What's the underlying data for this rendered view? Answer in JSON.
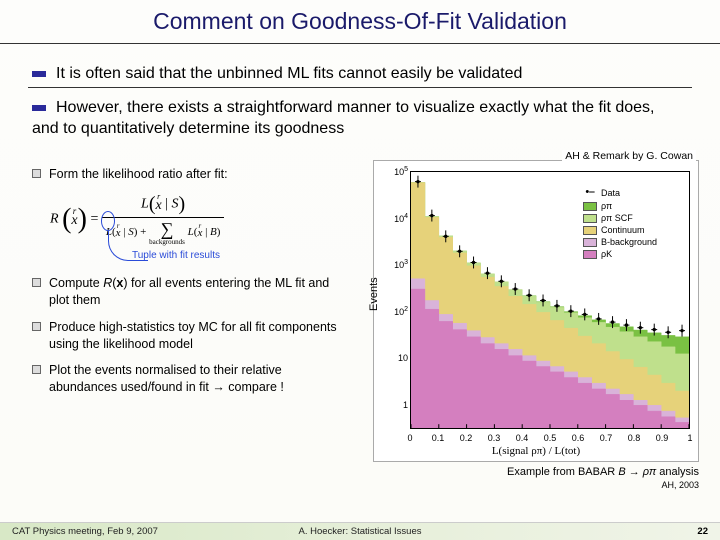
{
  "title": "Comment on Goodness-Of-Fit Validation",
  "bullets": {
    "b1": "It is often said that the unbinned ML fits cannot easily be validated",
    "b2": "However, there exists a straightforward manner to visualize exactly what the fit does, and to quantitatively determine its goodness"
  },
  "subs": {
    "s1": "Form the likelihood ratio after fit:",
    "s2_a": "Compute ",
    "s2_b": "R",
    "s2_c": "(",
    "s2_d": "x",
    "s2_e": ") for all events entering the ML fit and plot them",
    "s3": "Produce high-statistics toy MC for all fit components using the likelihood model",
    "s4": "Plot the events normalised to their relative abundances used/found in fit → compare !"
  },
  "eq": {
    "lhs_R": "R",
    "lhs_x": "x",
    "L": "L",
    "x": "x",
    "S": "S",
    "B": "B",
    "sum_label": "backgrounds"
  },
  "tuple_label": "Tuple with fit results",
  "chart_header": "AH & Remark by G. Cowan",
  "caption_r_a": "Example from BABAR ",
  "caption_r_b": "B → ρπ",
  "caption_r_c": " analysis",
  "caption_r2": "AH, 2003",
  "footer": {
    "left": "CAT Physics meeting, Feb 9, 2007",
    "mid": "A. Hoecker: Statistical Issues",
    "page": "22"
  },
  "chart_data": {
    "type": "area",
    "title": "",
    "xlabel": "L(signal ρπ) / L(tot)",
    "ylabel": "Events",
    "xlim": [
      0,
      1
    ],
    "ylim": [
      0.3,
      100000
    ],
    "yscale": "log",
    "yticks": [
      "1",
      "10",
      "10^2",
      "10^3",
      "10^4",
      "10^5"
    ],
    "xticks": [
      "0",
      "0.1",
      "0.2",
      "0.3",
      "0.4",
      "0.5",
      "0.6",
      "0.7",
      "0.8",
      "0.9",
      "1"
    ],
    "legend": {
      "items": [
        {
          "kind": "point",
          "label": "Data",
          "marker": "•"
        },
        {
          "kind": "fill",
          "label": "ρπ",
          "color": "#7ac143"
        },
        {
          "kind": "fill",
          "label": "ρπ SCF",
          "color": "#bfe08c"
        },
        {
          "kind": "fill",
          "label": "Continuum",
          "color": "#e6d27a"
        },
        {
          "kind": "fill",
          "label": "B-background",
          "color": "#d9b3d9"
        },
        {
          "kind": "fill",
          "label": "ρK",
          "color": "#d47fbf"
        }
      ]
    },
    "x": [
      0.025,
      0.075,
      0.125,
      0.175,
      0.225,
      0.275,
      0.325,
      0.375,
      0.425,
      0.475,
      0.525,
      0.575,
      0.625,
      0.675,
      0.725,
      0.775,
      0.825,
      0.875,
      0.925,
      0.975
    ],
    "series": [
      {
        "name": "ρπ",
        "color": "#7ac143",
        "values": [
          60000,
          11000,
          4200,
          2000,
          1100,
          640,
          430,
          290,
          215,
          160,
          125,
          98,
          80,
          65,
          54,
          46,
          39,
          34,
          30,
          28
        ]
      },
      {
        "name": "ρπ SCF",
        "color": "#bfe08c",
        "values": [
          60000,
          11000,
          4200,
          2000,
          1100,
          640,
          430,
          290,
          210,
          155,
          120,
          92,
          72,
          57,
          45,
          36,
          28,
          22,
          17,
          12
        ]
      },
      {
        "name": "Continuum",
        "color": "#e6d27a",
        "values": [
          59000,
          10500,
          3900,
          1800,
          950,
          540,
          340,
          210,
          140,
          94,
          63,
          43,
          29,
          20,
          13.5,
          9.1,
          6.2,
          4.2,
          2.8,
          1.9
        ]
      },
      {
        "name": "B-background",
        "color": "#d9b3d9",
        "values": [
          500,
          170,
          85,
          55,
          38,
          27,
          20,
          15,
          11,
          8.4,
          6.4,
          4.9,
          3.7,
          2.8,
          2.1,
          1.6,
          1.2,
          0.93,
          0.7,
          0.5
        ]
      },
      {
        "name": "ρK",
        "color": "#d47fbf",
        "values": [
          300,
          110,
          60,
          40,
          28,
          20,
          15,
          11,
          8.4,
          6.4,
          4.9,
          3.7,
          2.8,
          2.1,
          1.6,
          1.2,
          0.93,
          0.7,
          0.53,
          0.4
        ]
      }
    ],
    "data_points": [
      62000,
      11500,
      4100,
      1950,
      1120,
      660,
      440,
      300,
      220,
      170,
      130,
      100,
      85,
      68,
      58,
      50,
      44,
      40,
      35,
      38
    ]
  }
}
